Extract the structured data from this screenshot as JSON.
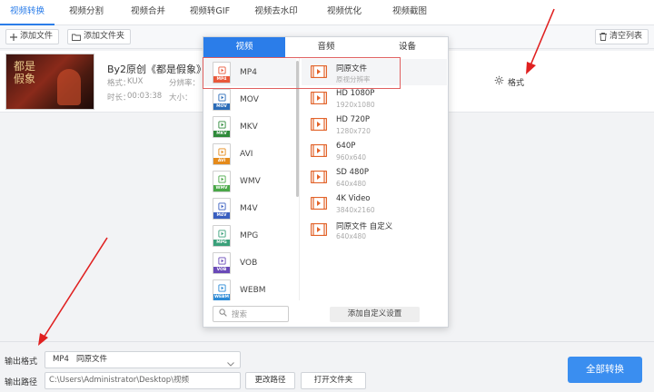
{
  "tabs": [
    "视频转换",
    "视频分割",
    "视频合并",
    "视频转GIF",
    "视频去水印",
    "视频优化",
    "视频截图"
  ],
  "toolbar": {
    "add_file": "添加文件",
    "add_folder": "添加文件夹",
    "clear_list": "清空列表"
  },
  "file": {
    "thumb_text": "都是\n假象",
    "name": "By2原创《都是假象》_..._沉",
    "format_label": "格式：",
    "format_value": "KUX",
    "resolution_label": "分辨率：",
    "duration_label": "时长：",
    "duration_value": "00:03:38",
    "size_label": "大小："
  },
  "format_button": "格式",
  "panel": {
    "tabs": [
      "视频",
      "音频",
      "设备"
    ],
    "formats": [
      "MP4",
      "MOV",
      "MKV",
      "AVI",
      "WMV",
      "M4V",
      "MPG",
      "VOB",
      "WEBM"
    ],
    "presets": [
      {
        "name": "同原文件",
        "res": "原视分辨率"
      },
      {
        "name": "HD 1080P",
        "res": "1920x1080"
      },
      {
        "name": "HD 720P",
        "res": "1280x720"
      },
      {
        "name": "640P",
        "res": "960x640"
      },
      {
        "name": "SD 480P",
        "res": "640x480"
      },
      {
        "name": "4K Video",
        "res": "3840x2160"
      },
      {
        "name": "同原文件 自定义",
        "res": "640x480"
      }
    ],
    "search_placeholder": "搜索",
    "custom_button": "添加自定义设置"
  },
  "bottom": {
    "output_format_label": "输出格式",
    "output_format_value": "MP4   同原文件",
    "output_path_label": "输出路径",
    "output_path_value": "C:\\Users\\Administrator\\Desktop\\视频",
    "change_path": "更改路径",
    "open_folder": "打开文件夹",
    "convert_all": "全部转换"
  },
  "colors": {
    "accent": "#2b7de9",
    "highlight": "#e06060",
    "arrow": "#e02020"
  }
}
